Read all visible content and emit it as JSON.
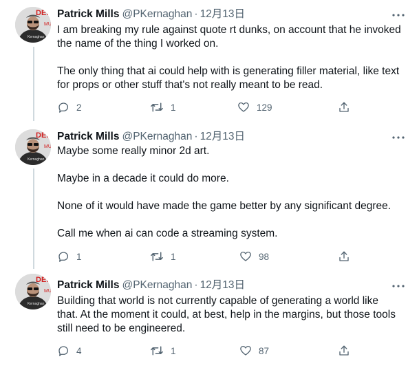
{
  "tweets": [
    {
      "name": "Patrick Mills",
      "handle": "@PKernaghan",
      "separator": "·",
      "date": "12月13日",
      "paragraphs": [
        "I am breaking my rule against quote rt dunks, on account that he invoked the name of the thing I worked on.",
        "",
        "The only thing that ai could help with is generating filler material, like text for props or other stuff that's not really meant to be read."
      ],
      "replies": "2",
      "retweets": "1",
      "likes": "129"
    },
    {
      "name": "Patrick Mills",
      "handle": "@PKernaghan",
      "separator": "·",
      "date": "12月13日",
      "paragraphs": [
        "Maybe some really minor 2d art.",
        "",
        "Maybe in a decade it could do more.",
        "",
        "None of it would have made the game better by any significant degree.",
        "",
        "Call me when ai can code a streaming system."
      ],
      "replies": "1",
      "retweets": "1",
      "likes": "98"
    },
    {
      "name": "Patrick Mills",
      "handle": "@PKernaghan",
      "separator": "·",
      "date": "12月13日",
      "paragraphs": [
        "Building that world is not currently capable of generating a world like that. At the moment it could, at best, help in the margins, but those tools still need to be engineered."
      ],
      "replies": "4",
      "retweets": "1",
      "likes": "87"
    }
  ],
  "avatar_text": "DER MUS",
  "colors": {
    "text": "#0f1419",
    "secondary": "#536471",
    "thread_line": "#cfd9de",
    "background": "#ffffff"
  },
  "icons": {
    "reply": "reply-icon",
    "retweet": "retweet-icon",
    "like": "heart-icon",
    "share": "share-icon",
    "more": "more-icon"
  }
}
